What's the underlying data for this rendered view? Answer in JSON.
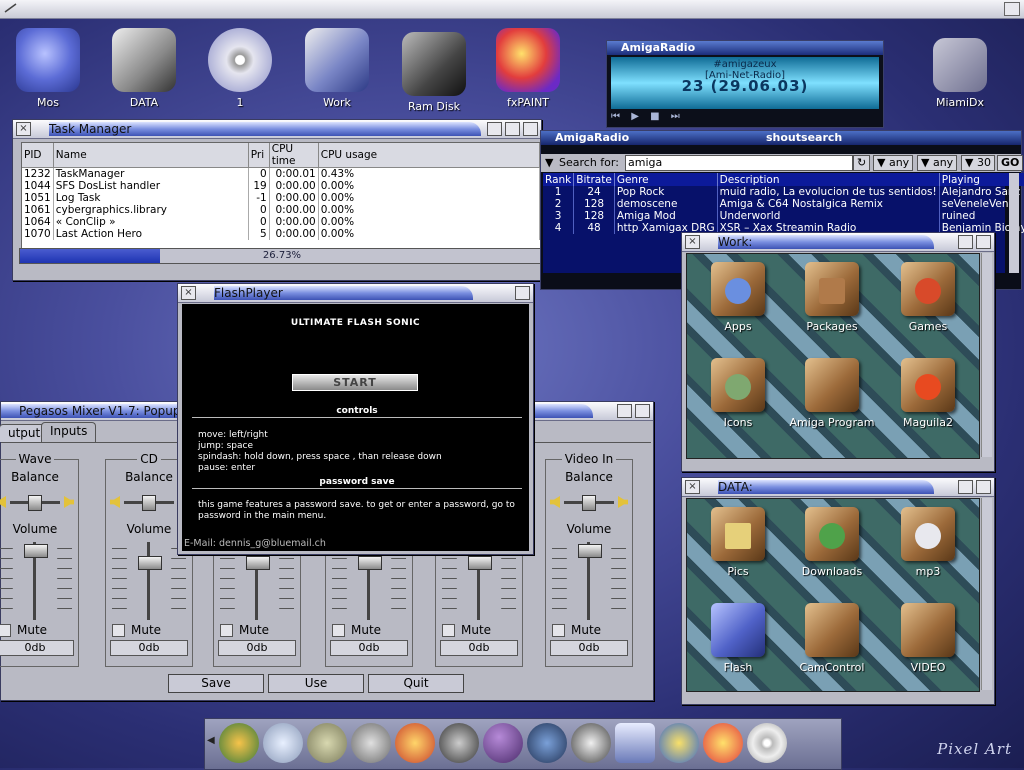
{
  "desktop": {
    "icons": [
      {
        "label": "Mos"
      },
      {
        "label": "DATA"
      },
      {
        "label": "1"
      },
      {
        "label": "Work"
      },
      {
        "label": "Ram Disk"
      },
      {
        "label": "fxPAINT"
      },
      {
        "label": "MiamiDx"
      }
    ],
    "branding": "Pixel Art"
  },
  "task_manager": {
    "title": "Task Manager",
    "columns": [
      "PID",
      "Name",
      "Pri",
      "CPU time",
      "CPU usage"
    ],
    "rows": [
      {
        "pid": "1232",
        "name": "TaskManager",
        "pri": "0",
        "time": "0:00.01",
        "usage": "0.43%"
      },
      {
        "pid": "1044",
        "name": "SFS DosList handler",
        "pri": "19",
        "time": "0:00.00",
        "usage": "0.00%"
      },
      {
        "pid": "1051",
        "name": "Log Task",
        "pri": "-1",
        "time": "0:00.00",
        "usage": "0.00%"
      },
      {
        "pid": "1061",
        "name": "cybergraphics.library",
        "pri": "0",
        "time": "0:00.00",
        "usage": "0.00%"
      },
      {
        "pid": "1064",
        "name": "« ConClip »",
        "pri": "0",
        "time": "0:00.00",
        "usage": "0.00%"
      },
      {
        "pid": "1070",
        "name": "Last Action Hero",
        "pri": "5",
        "time": "0:00.00",
        "usage": "0.00%"
      }
    ],
    "cpu_total_label": "26.73%",
    "cpu_total_fraction": 0.2673
  },
  "amigaradio_mini": {
    "title": "AmigaRadio",
    "channel": "#amigazeux",
    "station": "[Ami-Net-Radio]",
    "display": "23 (29.06.03)"
  },
  "shoutsearch": {
    "title": "AmigaRadio",
    "subtitle": "shoutsearch",
    "search_label": "Search for:",
    "search_value": "amiga",
    "filter1": "any",
    "filter2": "any",
    "limit": "30",
    "go_label": "GO",
    "columns": [
      "Rank",
      "Bitrate",
      "Genre",
      "Description",
      "Playing"
    ],
    "rows": [
      {
        "rank": "1",
        "bitrate": "24",
        "genre": "Pop Rock",
        "desc": "muid radio, La evolucion de tus sentidos!",
        "playing": "Alejandro Sanz"
      },
      {
        "rank": "2",
        "bitrate": "128",
        "genre": "demoscene",
        "desc": "Amiga & C64 Nostalgica Remix",
        "playing": "seVeneleVen –"
      },
      {
        "rank": "3",
        "bitrate": "128",
        "genre": "Amiga Mod",
        "desc": "Underworld",
        "playing": "ruined"
      },
      {
        "rank": "4",
        "bitrate": "48",
        "genre": "http  Xamigax DRG",
        "desc": "XSR – Xax Streamin Radio",
        "playing": "Benjamin Biolay"
      }
    ]
  },
  "work_window": {
    "title": "Work:",
    "items": [
      {
        "label": "Apps"
      },
      {
        "label": "Packages"
      },
      {
        "label": "Games"
      },
      {
        "label": "Icons"
      },
      {
        "label": "Amiga Program"
      },
      {
        "label": "Maguila2"
      }
    ]
  },
  "data_window": {
    "title": "DATA:",
    "items": [
      {
        "label": "Pics"
      },
      {
        "label": "Downloads"
      },
      {
        "label": "mp3"
      },
      {
        "label": "Flash"
      },
      {
        "label": "CamControl"
      },
      {
        "label": "VIDEO"
      }
    ]
  },
  "flash_player": {
    "title": "FlashPlayer",
    "game_title": "ULTIMATE FLASH SONIC",
    "start_label": "START",
    "controls_heading": "controls",
    "controls_lines": [
      "move: left/right",
      "jump: space",
      "spindash: hold down, press space , than release down",
      "pause: enter"
    ],
    "password_heading": "password save",
    "password_text": "this game features a password save.  to get or enter a password, go to password in the main menu.",
    "email": "E-Mail: dennis_g@bluemail.ch"
  },
  "mixer": {
    "title": "Pegasos Mixer V1.7: Popup",
    "tabs": [
      "utputs",
      "Inputs"
    ],
    "balance_label": "Balance",
    "volume_label": "Volume",
    "mute_label": "Mute",
    "channels": [
      {
        "name": "Wave",
        "db": "0db"
      },
      {
        "name": "CD",
        "db": "0db"
      },
      {
        "name": "",
        "db": "0db"
      },
      {
        "name": "",
        "db": "0db"
      },
      {
        "name": "",
        "db": "0db"
      },
      {
        "name": "Video In",
        "db": "0db"
      }
    ],
    "buttons": {
      "save": "Save",
      "use": "Use",
      "quit": "Quit"
    }
  }
}
